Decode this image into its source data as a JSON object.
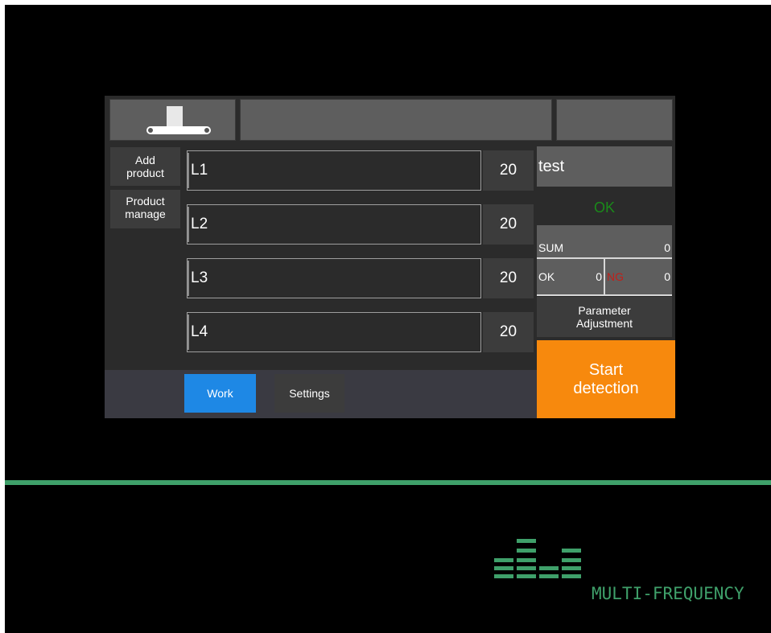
{
  "header": {
    "conveyor_icon": "conveyor-belt-icon",
    "title": "",
    "right": ""
  },
  "sidebar": {
    "add_product": "Add\nproduct",
    "product_manage": "Product\nmanage"
  },
  "lanes": [
    {
      "label": "L1",
      "value": "20"
    },
    {
      "label": "L2",
      "value": "20"
    },
    {
      "label": "L3",
      "value": "20"
    },
    {
      "label": "L4",
      "value": "20"
    }
  ],
  "product": {
    "name": "test"
  },
  "status": {
    "text": "OK",
    "color": "#1a8a1a"
  },
  "counters": {
    "sum_label": "SUM",
    "sum_value": "0",
    "ok_label": "OK",
    "ok_value": "0",
    "ng_label": "NG",
    "ng_value": "0",
    "ng_color": "#c0201a"
  },
  "buttons": {
    "parameter_adjustment": "Parameter\nAdjustment",
    "start_detection": "Start\ndetection",
    "start_color": "#f7890d"
  },
  "tabs": {
    "work": "Work",
    "settings": "Settings",
    "active_color": "#1e88e5"
  },
  "brand": {
    "logo_icon": "equalizer-bars-icon",
    "text": "MULTI-FREQUENCY",
    "color": "#3fa06a"
  }
}
